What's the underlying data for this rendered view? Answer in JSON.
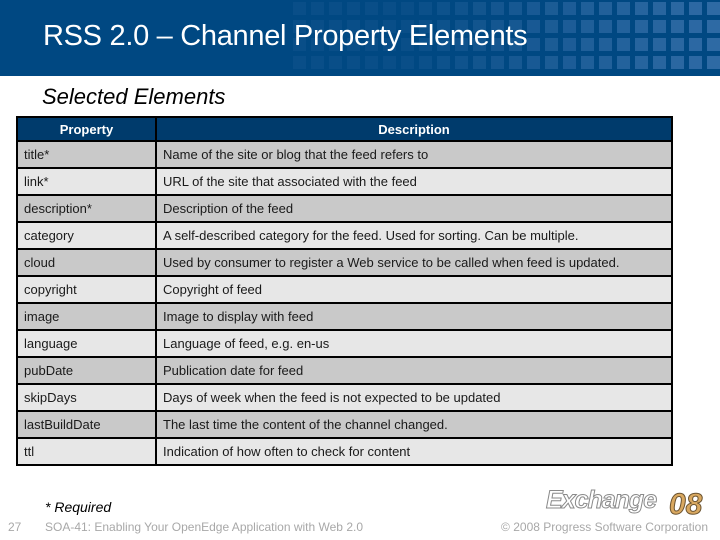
{
  "slide": {
    "title": "RSS 2.0 – Channel Property Elements",
    "subtitle": "Selected Elements",
    "footnote": "* Required",
    "page_number": "27",
    "footer_title": "SOA-41: Enabling Your OpenEdge Application with Web 2.0",
    "copyright": "© 2008 Progress Software Corporation",
    "logo": {
      "word": "Exchange",
      "number": "08"
    }
  },
  "colors": {
    "header_bg": "#004882",
    "table_header_bg": "#003b6c",
    "row_dark": "#c9c9c9",
    "row_light": "#e7e7e7",
    "logo_accent": "#d9a860"
  },
  "table": {
    "columns": [
      "Property",
      "Description"
    ],
    "rows": [
      [
        "title*",
        "Name of the site or blog that the feed refers to"
      ],
      [
        "link*",
        "URL of the site that associated with the feed"
      ],
      [
        "description*",
        "Description of the feed"
      ],
      [
        "category",
        "A self-described category for the feed.  Used for sorting. Can be multiple."
      ],
      [
        "cloud",
        "Used by consumer to register a Web service to be called when feed is updated."
      ],
      [
        "copyright",
        "Copyright of feed"
      ],
      [
        "image",
        "Image to display with feed"
      ],
      [
        "language",
        "Language of feed, e.g. en-us"
      ],
      [
        "pubDate",
        "Publication date for feed"
      ],
      [
        "skipDays",
        "Days of week when the feed is not expected to be updated"
      ],
      [
        "lastBuildDate",
        "The last time the content of the channel changed."
      ],
      [
        "ttl",
        "Indication of how often to check for content"
      ]
    ]
  }
}
